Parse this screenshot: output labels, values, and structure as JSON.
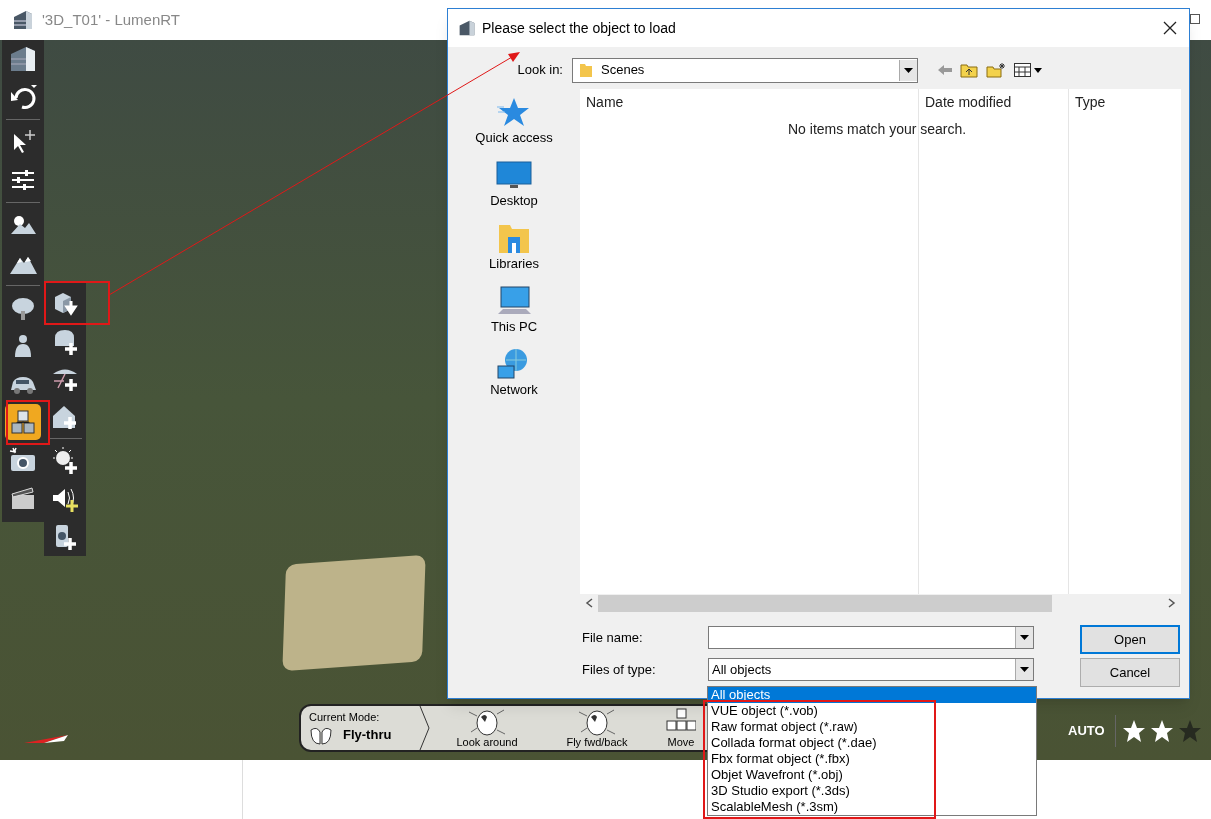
{
  "window": {
    "title": "'3D_T01' - LumenRT"
  },
  "left_toolbar": {
    "groups": [
      [
        {
          "kind": "logo",
          "selected": false
        },
        {
          "kind": "undo",
          "selected": false
        }
      ],
      [
        {
          "kind": "select",
          "selected": false
        },
        {
          "kind": "sliders",
          "selected": false
        }
      ],
      [
        {
          "kind": "sky",
          "selected": false
        },
        {
          "kind": "mountain",
          "selected": false
        }
      ],
      [
        {
          "kind": "tree",
          "selected": false
        },
        {
          "kind": "person",
          "selected": false
        },
        {
          "kind": "car",
          "selected": false
        },
        {
          "kind": "objects",
          "selected": true
        },
        {
          "kind": "camera",
          "selected": false
        },
        {
          "kind": "clapper",
          "selected": false
        }
      ]
    ]
  },
  "sub_toolbar": {
    "groups": [
      [
        {
          "kind": "load-object",
          "selected": false
        },
        {
          "kind": "add-furniture",
          "selected": false
        },
        {
          "kind": "add-umbrella",
          "selected": false
        },
        {
          "kind": "add-house",
          "selected": false
        }
      ],
      [
        {
          "kind": "add-light",
          "selected": false
        },
        {
          "kind": "add-sound",
          "selected": false
        },
        {
          "kind": "add-speaker",
          "selected": false
        }
      ]
    ]
  },
  "dialog": {
    "title": "Please select the object to load",
    "look_in": {
      "label": "Look in:",
      "value": "Scenes"
    },
    "places": [
      {
        "kind": "quick-access",
        "label": "Quick access"
      },
      {
        "kind": "desktop",
        "label": "Desktop"
      },
      {
        "kind": "libraries",
        "label": "Libraries"
      },
      {
        "kind": "this-pc",
        "label": "This PC"
      },
      {
        "kind": "network",
        "label": "Network"
      }
    ],
    "columns": [
      "Name",
      "Date modified",
      "Type"
    ],
    "empty_message": "No items match your search.",
    "file_name": {
      "label": "File name:"
    },
    "files_of_type": {
      "label": "Files of type:",
      "value": "All objects",
      "options": [
        {
          "label": "All objects",
          "selected": true
        },
        {
          "label": "VUE object (*.vob)",
          "selected": false
        },
        {
          "label": "Raw format object (*.raw)",
          "selected": false
        },
        {
          "label": "Collada format object (*.dae)",
          "selected": false
        },
        {
          "label": "Fbx format object (*.fbx)",
          "selected": false
        },
        {
          "label": "Objet Wavefront (*.obj)",
          "selected": false
        },
        {
          "label": "3D Studio export (*.3ds)",
          "selected": false
        },
        {
          "label": "ScalableMesh (*.3sm)",
          "selected": false
        }
      ]
    },
    "buttons": [
      "Open",
      "Cancel"
    ]
  },
  "mode_bar": {
    "caption": "Current Mode:",
    "mode": "Fly-thru",
    "actions": [
      "Look around",
      "Fly fwd/back",
      "Move"
    ]
  },
  "quality": {
    "label": "AUTO",
    "stars": 2
  }
}
